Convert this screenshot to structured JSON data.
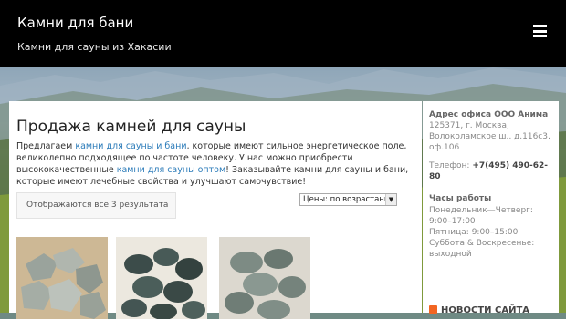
{
  "header": {
    "site_title": "Камни для бани",
    "site_description": "Камни для сауны из Хакасии"
  },
  "main": {
    "title": "Продажа камней для сауны",
    "intro_1": "Предлагаем ",
    "link_1": "камни для сауны и бани",
    "intro_2": ", которые имеют сильное энергетическое поле, великолепно подходящее по частоте человеку. У нас можно приобрести высококачественные ",
    "link_2": "камни для сауны оптом",
    "intro_3": "! Заказывайте камни для сауны и бани, которые имеют лечебные свойства и улучшают самочувствие!",
    "result_count": "Отображаются все 3 результата",
    "sort_value": "Цены: по возрастанию"
  },
  "sidebar": {
    "address_title": "Адрес офиса ООО Анима",
    "address": "125371, г. Москва, Волоколамское ш., д.116с3, оф.106",
    "phone_label": "Телефон: ",
    "phone": "+7(495) 490-62-80",
    "hours_title": "Часы работы",
    "hours_1": "Понедельник—Четверг: 9:00–17:00",
    "hours_2": "Пятница: 9:00–15:00",
    "hours_3": "Суббота & Воскресенье: выходной",
    "news_title": "НОВОСТИ САЙТА"
  },
  "icons": {
    "menu": "hamburger-menu-icon",
    "rss": "rss-icon"
  },
  "colors": {
    "header_bg": "#000000",
    "link": "#2b7bb9",
    "rss": "#f26522"
  }
}
